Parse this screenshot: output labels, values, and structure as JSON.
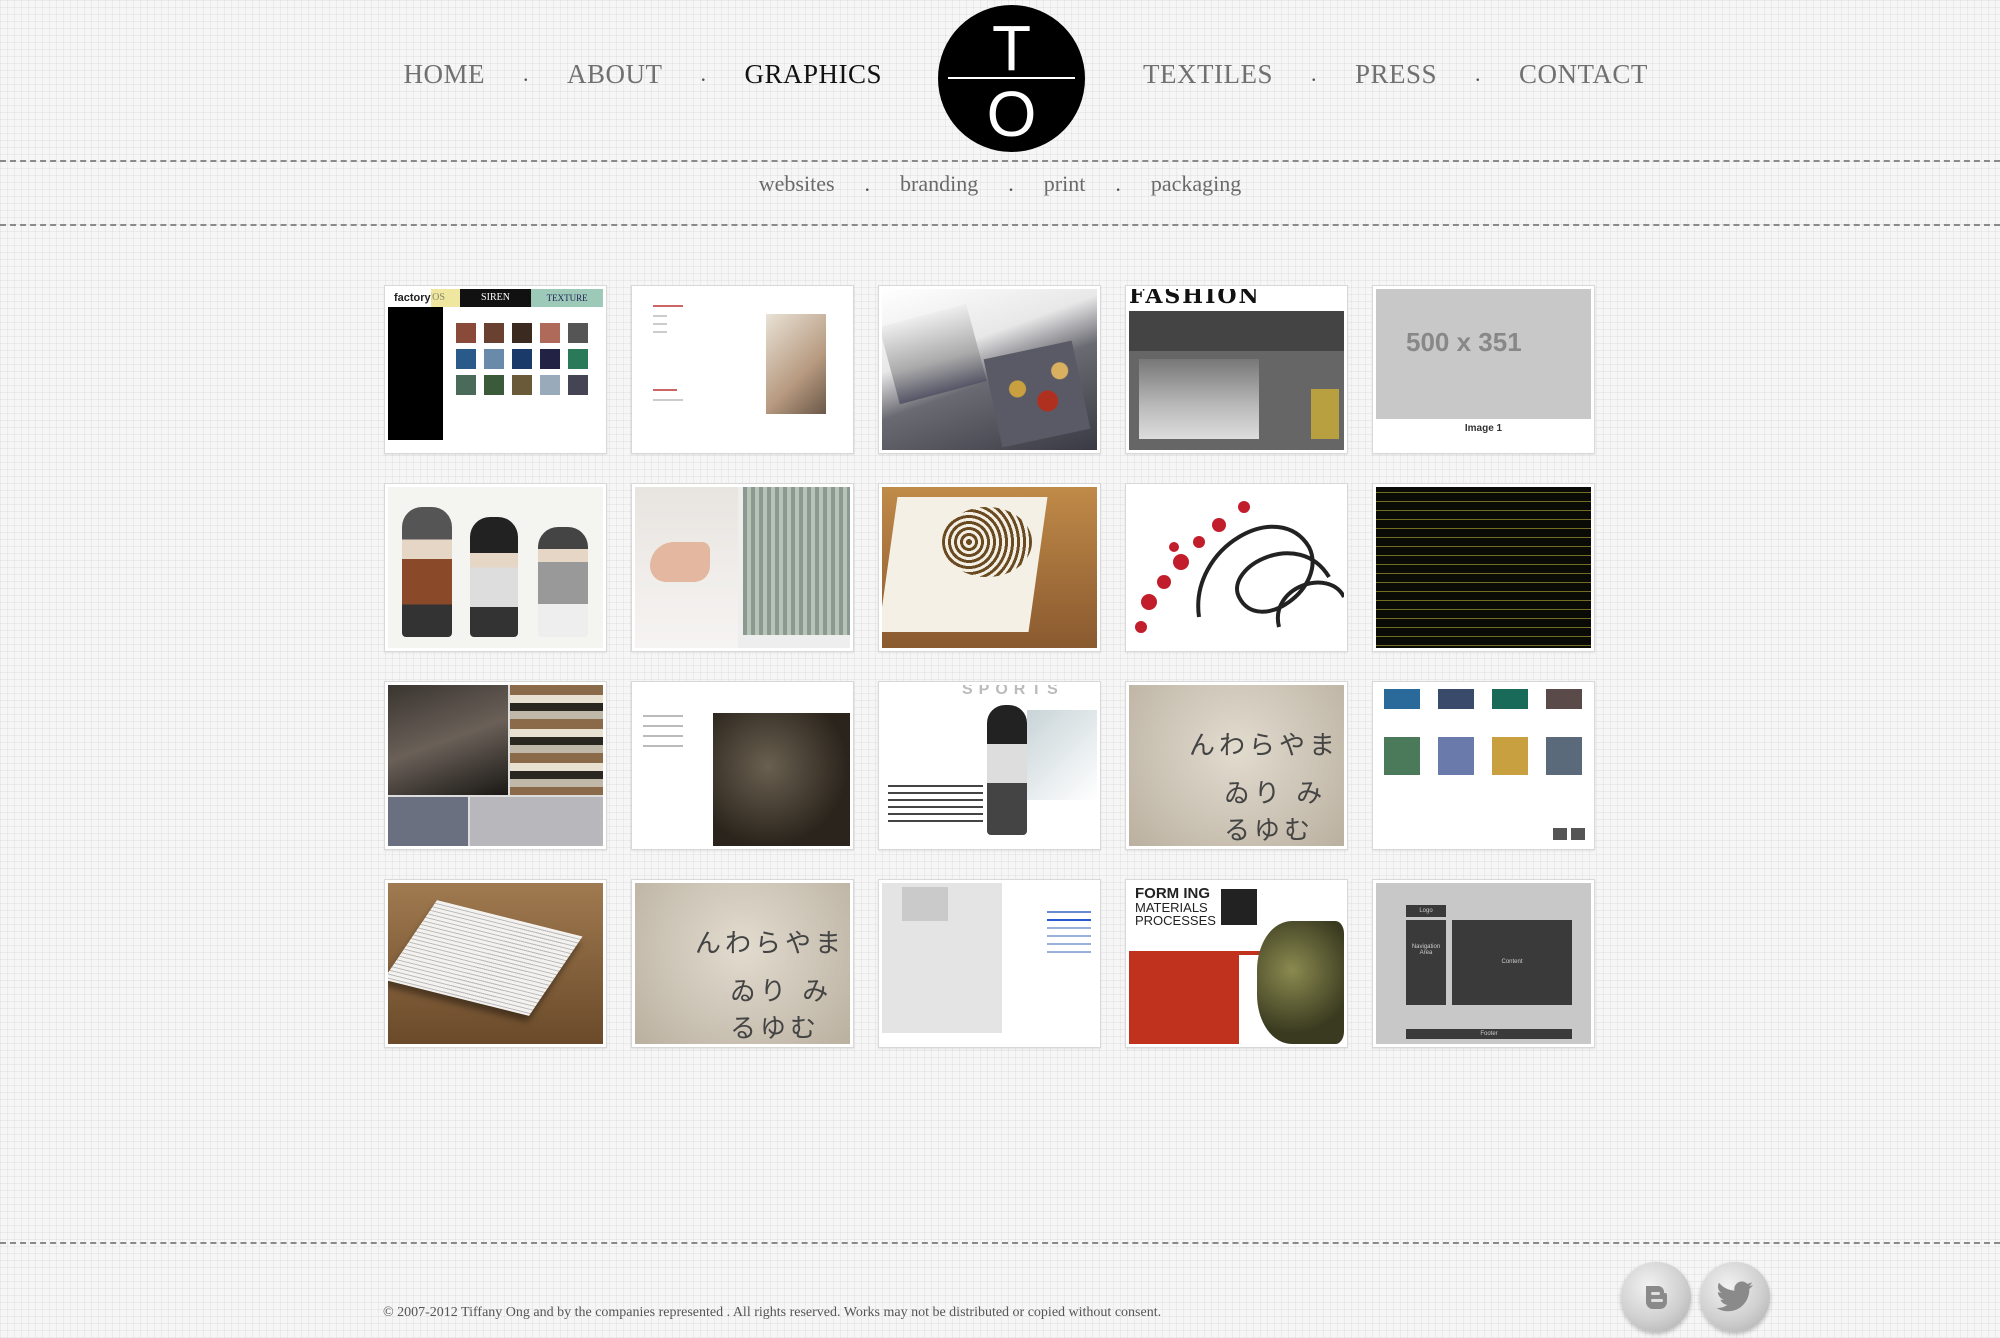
{
  "nav": {
    "left": [
      "HOME",
      "ABOUT",
      "GRAPHICS"
    ],
    "right": [
      "TEXTILES",
      "PRESS",
      "CONTACT"
    ],
    "separator": ".",
    "active": "GRAPHICS"
  },
  "logo": {
    "top_letter": "T",
    "bottom_letter": "O"
  },
  "subnav": {
    "items": [
      "websites",
      "branding",
      "print",
      "packaging"
    ],
    "separator": "."
  },
  "thumbnails": {
    "t1": {
      "brand": "factory",
      "tab1": "STUDIOS",
      "tab2": "SIREN",
      "tab3": "TEXTURE"
    },
    "t5": {
      "size": "500 x 351",
      "caption": "Image 1"
    },
    "t13": {
      "heading": "SPORTS"
    },
    "t14": {
      "kana_row1": "んわらやま",
      "kana_row2": "ゐり み",
      "kana_row3": "るゆむ"
    },
    "t17": {
      "kana_row1": "んわらやま",
      "kana_row2": "ゐり み",
      "kana_row3": "るゆむ"
    },
    "t19": {
      "title_line1": "FORM  ING",
      "title_line2": "MATERIALS",
      "title_line3": "PROCESSES"
    },
    "t20": {
      "logo": "Logo",
      "nav_area": "Navigation Area",
      "content": "Content",
      "footer": "Footer"
    }
  },
  "footer": {
    "copyright": "© 2007-2012 Tiffany Ong and by the companies represented . All rights reserved. Works may not be distributed or copied without consent."
  },
  "social": {
    "icons": [
      "blogger-icon",
      "twitter-icon"
    ]
  },
  "colors": {
    "background": "#f6f6f6",
    "active_nav": "#111111",
    "nav": "#707070",
    "logo": "#000000"
  }
}
